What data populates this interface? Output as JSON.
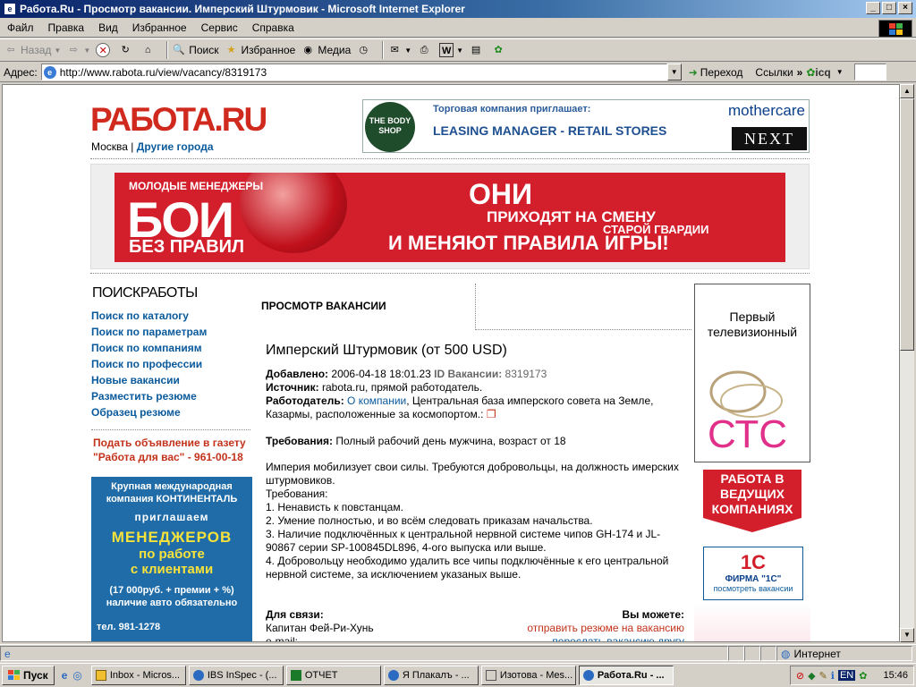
{
  "window": {
    "title": "Работа.Ru - Просмотр вакансии. Имперский Штурмовик - Microsoft Internet Explorer"
  },
  "menu": [
    "Файл",
    "Правка",
    "Вид",
    "Избранное",
    "Сервис",
    "Справка"
  ],
  "toolbar": {
    "back": "Назад",
    "search": "Поиск",
    "favorites": "Избранное",
    "media": "Медиа"
  },
  "address": {
    "label": "Адрес:",
    "url": "http://www.rabota.ru/view/vacancy/8319173",
    "go": "Переход",
    "links": "Ссылки",
    "icq": "icq"
  },
  "page": {
    "logo": "РАБОТА.RU",
    "city": "Москва",
    "other_cities": "Другие города",
    "top_banner": {
      "bodyshop": "THE BODY SHOP",
      "line1": "Торговая компания приглашает:",
      "line2": "LEASING MANAGER - RETAIL STORES",
      "brand1": "mothercare",
      "brand2": "NEXT"
    },
    "big_banner": {
      "small": "МОЛОДЫЕ МЕНЕДЖЕРЫ",
      "boi": "БОИ",
      "bez": "БЕЗ ПРАВИЛ",
      "oni": "ОНИ",
      "l2": "ПРИХОДЯТ НА СМЕНУ",
      "l3": "СТАРОЙ ГВАРДИИ",
      "l4": "И МЕНЯЮТ ПРАВИЛА ИГРЫ!"
    },
    "search_heading_a": "ПОИСК",
    "search_heading_b": "РАБОТЫ",
    "sidenav": [
      "Поиск по каталогу",
      "Поиск по параметрам",
      "Поиск по компаниям",
      "Поиск по профессии",
      "Новые вакансии",
      "Разместить резюме",
      "Образец резюме"
    ],
    "gazeta_line1": "Подать объявление в газету",
    "gazeta_line2": "\"Работа для вас\" - 961-00-18",
    "cont_ad": {
      "c1a": "Крупная международная",
      "c1b": "компания КОНТИНЕНТАЛЬ",
      "c2": "приглашаем",
      "c3": "МЕНЕДЖЕРОВ",
      "c4a": "по работе",
      "c4b": "с клиентами",
      "c5a": "(17 000руб. + премии + %)",
      "c5b": "наличие авто обязательно",
      "c6": "тел. 981-1278"
    },
    "view_heading": "ПРОСМОТР ВАКАНСИИ",
    "vacancy": {
      "title": "Имперский Штурмовик (от 500 USD)",
      "added_label": "Добавлено:",
      "added_value": "2006-04-18 18:01.23",
      "id_label": "ID Вакансии:",
      "id_value": "8319173",
      "source_label": "Источник:",
      "source_value": "rabota.ru, прямой работодатель.",
      "employer_label": "Работодатель:",
      "employer_link": "О компании",
      "employer_value": ", Центральная база имперского совета на Земле, Казармы, расположенные за космопортом.:",
      "req_label": "Требования:",
      "req_value": "Полный рабочий день  мужчина, возраст от 18",
      "desc_intro": "Империя мобилизует свои силы. Требуются добровольцы, на должность имерских штурмовиков.",
      "desc_req": "Требования:",
      "desc_items": [
        "1. Ненависть к повстанцам.",
        "2. Умение полностью, и во всём следовать приказам начальства.",
        "3. Наличие подключённых к центральной нервной системе чипов GH-174 и JL-90867 серии SP-100845DL896, 4-ого выпуска или выше.",
        "4. Добровольцу необходимо удалить все чипы подключённые к его центральной нервной системе, за исключением указаных выше."
      ],
      "contact_label": "Для связи:",
      "contact_name": "Капитан Фей-Ри-Хунь",
      "email_label": "e-mail:",
      "you_can": "Вы можете:",
      "send_resume": "отправить резюме на вакансию",
      "forward": "переслать вакансию другу"
    },
    "right_ad_text": "Первый телевизионный",
    "right_banner": "РАБОТА В ВЕДУЩИХ КОМПАНИЯХ",
    "onec": {
      "logo": "1C",
      "firm": "ФИРМА \"1С\"",
      "link": "посмотреть вакансии"
    }
  },
  "status": {
    "zone": "Интернет"
  },
  "taskbar": {
    "start": "Пуск",
    "tasks": [
      "Inbox - Micros...",
      "IBS InSpec - (...",
      "ОТЧЕТ",
      "Я Плакалъ - ...",
      "Изотова - Mes...",
      "Работа.Ru - ..."
    ],
    "lang": "EN",
    "clock": "15:46"
  },
  "colors": {
    "accent_red": "#d21f2b",
    "link_blue": "#0a5a9c",
    "title_blue": "#0a246a"
  }
}
